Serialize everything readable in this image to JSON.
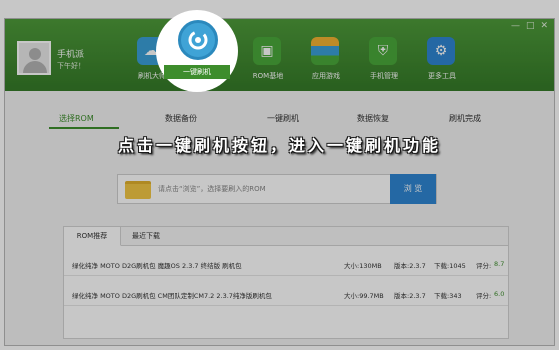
{
  "window": {
    "controls": [
      "—",
      "□",
      "✕"
    ]
  },
  "user": {
    "name": "手机派",
    "greeting": "下午好！"
  },
  "nav": [
    {
      "label": "刷机大师",
      "icon": "cloud-icon",
      "color": "#3a9fd8"
    },
    {
      "label": "一键刷机",
      "icon": "refresh-icon",
      "color": "#3fa3d6"
    },
    {
      "label": "ROM基地",
      "icon": "bag-icon",
      "color": "#4aa83a"
    },
    {
      "label": "应用游戏",
      "icon": "apps-icon",
      "color": "#2f86d2"
    },
    {
      "label": "手机管理",
      "icon": "shield-icon",
      "color": "#4aa83a"
    },
    {
      "label": "更多工具",
      "icon": "tools-icon",
      "color": "#2f86d2"
    }
  ],
  "steps": [
    "选择ROM",
    "数据备份",
    "一键刷机",
    "数据恢复",
    "刷机完成"
  ],
  "annotation": "点击一键刷机按钮，进入一键刷机功能",
  "browse": {
    "placeholder": "请点击“浏览”，选择要刷入的ROM",
    "button": "浏 览"
  },
  "tabs": [
    "ROM推荐",
    "最近下载"
  ],
  "roms": [
    {
      "title": "绿化纯净 MOTO D2G刷机包 魔趣OS 2.3.7 终结版 刷机包",
      "size": "大小:130MB",
      "version": "版本:2.3.7",
      "downloads": "下载:1045",
      "score_label": "评分:",
      "score": "8.7"
    },
    {
      "title": "绿化纯净 MOTO D2G刷机包 CM团队定制CM7.2 2.3.7纯净版刷机包",
      "size": "大小:99.7MB",
      "version": "版本:2.3.7",
      "downloads": "下载:343",
      "score_label": "评分:",
      "score": "6.0"
    }
  ],
  "colors": {
    "header": "#4e9b3a",
    "accent": "#3d8d2c",
    "button": "#2f86d2"
  }
}
